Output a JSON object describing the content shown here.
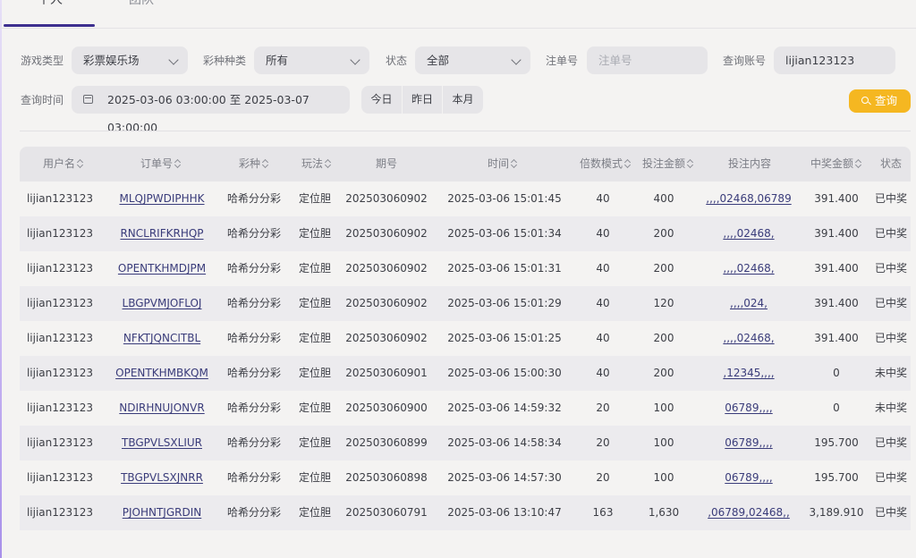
{
  "tabs": [
    {
      "label": "个人"
    },
    {
      "label": "团队"
    }
  ],
  "filters": {
    "game_type": {
      "label": "游戏类型",
      "value": "彩票娱乐场"
    },
    "lottery_kind": {
      "label": "彩种种类",
      "value": "所有"
    },
    "status": {
      "label": "状态",
      "value": "全部"
    },
    "order_no": {
      "label": "注单号",
      "placeholder": "注单号"
    },
    "account": {
      "label": "查询账号",
      "value": "lijian123123"
    },
    "time": {
      "label": "查询时间",
      "value": "2025-03-06 03:00:00 至 2025-03-07 03:00:00"
    },
    "quick": [
      "今日",
      "昨日",
      "本月"
    ],
    "search_label": "查询"
  },
  "table": {
    "columns": [
      "用户名",
      "订单号",
      "彩种",
      "玩法",
      "期号",
      "时间",
      "倍数模式",
      "投注金额",
      "投注内容",
      "中奖金额",
      "状态"
    ],
    "rows": [
      [
        "lijian123123",
        "MLQJPWDIPHHK",
        "哈希分分彩",
        "定位胆",
        "202503060902",
        "2025-03-06 15:01:45",
        "40",
        "400",
        ",,,,02468,06789",
        "391.400",
        "已中奖"
      ],
      [
        "lijian123123",
        "RNCLRIFKRHQP",
        "哈希分分彩",
        "定位胆",
        "202503060902",
        "2025-03-06 15:01:34",
        "40",
        "200",
        ",,,,02468,",
        "391.400",
        "已中奖"
      ],
      [
        "lijian123123",
        "OPENTKHMDJPM",
        "哈希分分彩",
        "定位胆",
        "202503060902",
        "2025-03-06 15:01:31",
        "40",
        "200",
        ",,,,02468,",
        "391.400",
        "已中奖"
      ],
      [
        "lijian123123",
        "LBGPVMJOFLOJ",
        "哈希分分彩",
        "定位胆",
        "202503060902",
        "2025-03-06 15:01:29",
        "40",
        "120",
        ",,,,024,",
        "391.400",
        "已中奖"
      ],
      [
        "lijian123123",
        "NFKTJQNCITBL",
        "哈希分分彩",
        "定位胆",
        "202503060902",
        "2025-03-06 15:01:25",
        "40",
        "200",
        ",,,,02468,",
        "391.400",
        "已中奖"
      ],
      [
        "lijian123123",
        "OPENTKHMBKQM",
        "哈希分分彩",
        "定位胆",
        "202503060901",
        "2025-03-06 15:00:30",
        "40",
        "200",
        ",12345,,,,",
        "0",
        "未中奖"
      ],
      [
        "lijian123123",
        "NDIRHNUJONVR",
        "哈希分分彩",
        "定位胆",
        "202503060900",
        "2025-03-06 14:59:32",
        "20",
        "100",
        "06789,,,,",
        "0",
        "未中奖"
      ],
      [
        "lijian123123",
        "TBGPVLSXLIUR",
        "哈希分分彩",
        "定位胆",
        "202503060899",
        "2025-03-06 14:58:34",
        "20",
        "100",
        "06789,,,,",
        "195.700",
        "已中奖"
      ],
      [
        "lijian123123",
        "TBGPVLSXJNRR",
        "哈希分分彩",
        "定位胆",
        "202503060898",
        "2025-03-06 14:57:30",
        "20",
        "100",
        "06789,,,,",
        "195.700",
        "已中奖"
      ],
      [
        "lijian123123",
        "PJOHNTJGRDIN",
        "哈希分分彩",
        "定位胆",
        "202503060791",
        "2025-03-06 13:10:47",
        "163",
        "1,630",
        ",06789,02468,,",
        "3,189.910",
        "已中奖"
      ]
    ]
  }
}
